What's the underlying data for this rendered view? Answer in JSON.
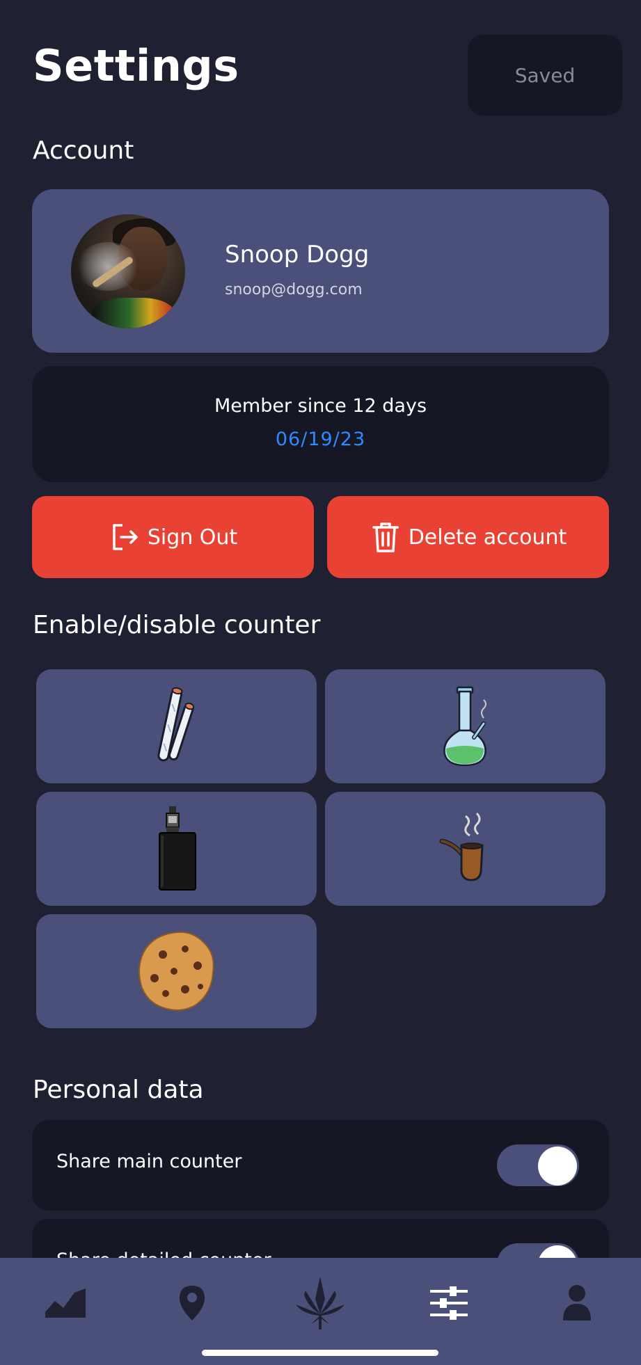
{
  "header": {
    "title": "Settings",
    "saved_label": "Saved"
  },
  "sections": {
    "account": "Account",
    "counters": "Enable/disable counter",
    "personal": "Personal data"
  },
  "profile": {
    "name": "Snoop Dogg",
    "email": "snoop@dogg.com"
  },
  "membership": {
    "label": "Member since 12 days",
    "date": "06/19/23"
  },
  "actions": {
    "sign_out": "Sign Out",
    "delete": "Delete account"
  },
  "counters": [
    {
      "icon": "joints-icon",
      "enabled": true
    },
    {
      "icon": "bong-icon",
      "enabled": true
    },
    {
      "icon": "vape-icon",
      "enabled": true
    },
    {
      "icon": "pipe-icon",
      "enabled": true
    },
    {
      "icon": "cookie-icon",
      "enabled": true
    }
  ],
  "personal_data": [
    {
      "label": "Share main counter",
      "on": true
    },
    {
      "label": "Share detailed counter",
      "on": true
    }
  ],
  "nav": [
    {
      "icon": "stats-icon"
    },
    {
      "icon": "map-pin-icon"
    },
    {
      "icon": "cannabis-leaf-icon"
    },
    {
      "icon": "sliders-icon",
      "active": true
    },
    {
      "icon": "user-icon"
    }
  ],
  "colors": {
    "background": "#1f2133",
    "card": "#4a5079",
    "dark_card": "#151724",
    "danger": "#e94235",
    "accent_blue": "#2e8bff"
  }
}
